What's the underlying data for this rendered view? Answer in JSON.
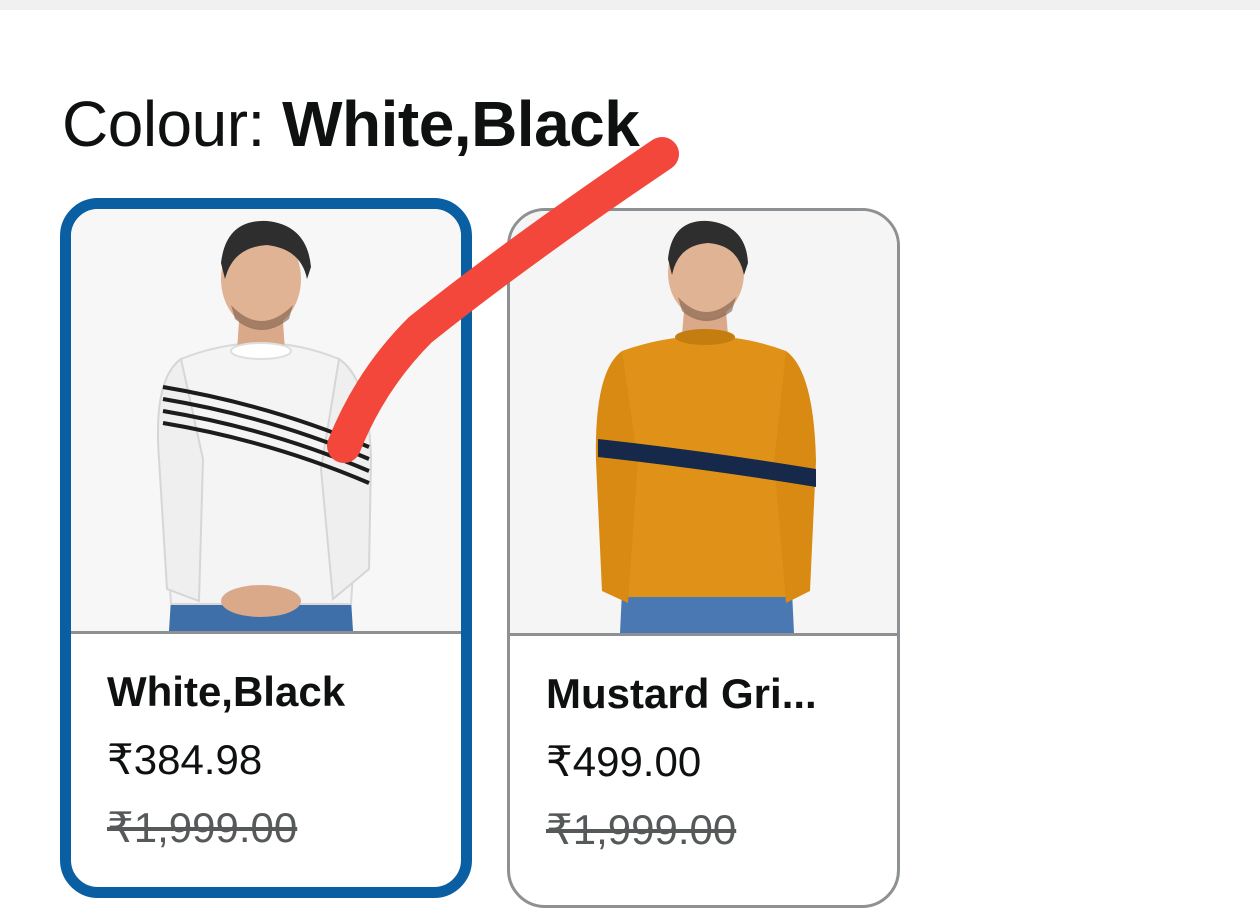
{
  "colour_selector": {
    "label": "Colour: ",
    "selected_value": "White,Black"
  },
  "swatches": [
    {
      "name": "White,Black",
      "price": "₹384.98",
      "mrp": "₹1,999.00",
      "selected": true,
      "sweater_color": "#f4f4f4",
      "stripe_color": "#1c1c1c"
    },
    {
      "name": "Mustard Gri...",
      "price": "₹499.00",
      "mrp": "₹1,999.00",
      "selected": false,
      "sweater_color": "#e09218",
      "stripe_color": "#16294a"
    }
  ],
  "colors": {
    "selected_border": "#0a5fa3",
    "unselected_border": "#8d9193",
    "annotation_stroke": "#f2473a"
  }
}
